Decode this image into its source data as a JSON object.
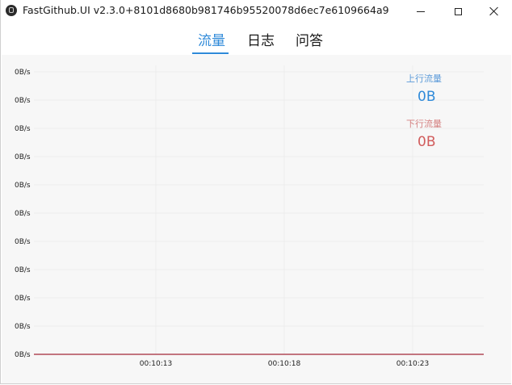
{
  "window": {
    "title": "FastGithub.UI v2.3.0+8101d8680b981746b95520078d6ec7e6109664a9",
    "icon": "github-icon",
    "controls": {
      "minimize": "minimize-icon",
      "maximize": "maximize-icon",
      "close": "close-icon"
    }
  },
  "tabs": [
    {
      "label": "流量",
      "active": true
    },
    {
      "label": "日志",
      "active": false
    },
    {
      "label": "问答",
      "active": false
    }
  ],
  "legend": {
    "upload_label": "上行流量",
    "upload_value": "0B",
    "download_label": "下行流量",
    "download_value": "0B"
  },
  "colors": {
    "accent": "#2f8ad9",
    "upload": "#2f8ad9",
    "download": "#d15c5c",
    "panel_bg": "#f7f7f7"
  },
  "chart_data": {
    "type": "line",
    "title": "",
    "xlabel": "",
    "ylabel": "",
    "y_tick_labels": [
      "0B/s",
      "0B/s",
      "0B/s",
      "0B/s",
      "0B/s",
      "0B/s",
      "0B/s",
      "0B/s",
      "0B/s",
      "0B/s",
      "0B/s"
    ],
    "x_tick_labels": [
      "00:10:13",
      "00:10:18",
      "00:10:23"
    ],
    "grid": true,
    "legend_position": "top-right",
    "series": [
      {
        "name": "上行流量",
        "color": "#2f8ad9",
        "values": [
          0,
          0,
          0
        ]
      },
      {
        "name": "下行流量",
        "color": "#d15c5c",
        "values": [
          0,
          0,
          0
        ]
      }
    ]
  }
}
